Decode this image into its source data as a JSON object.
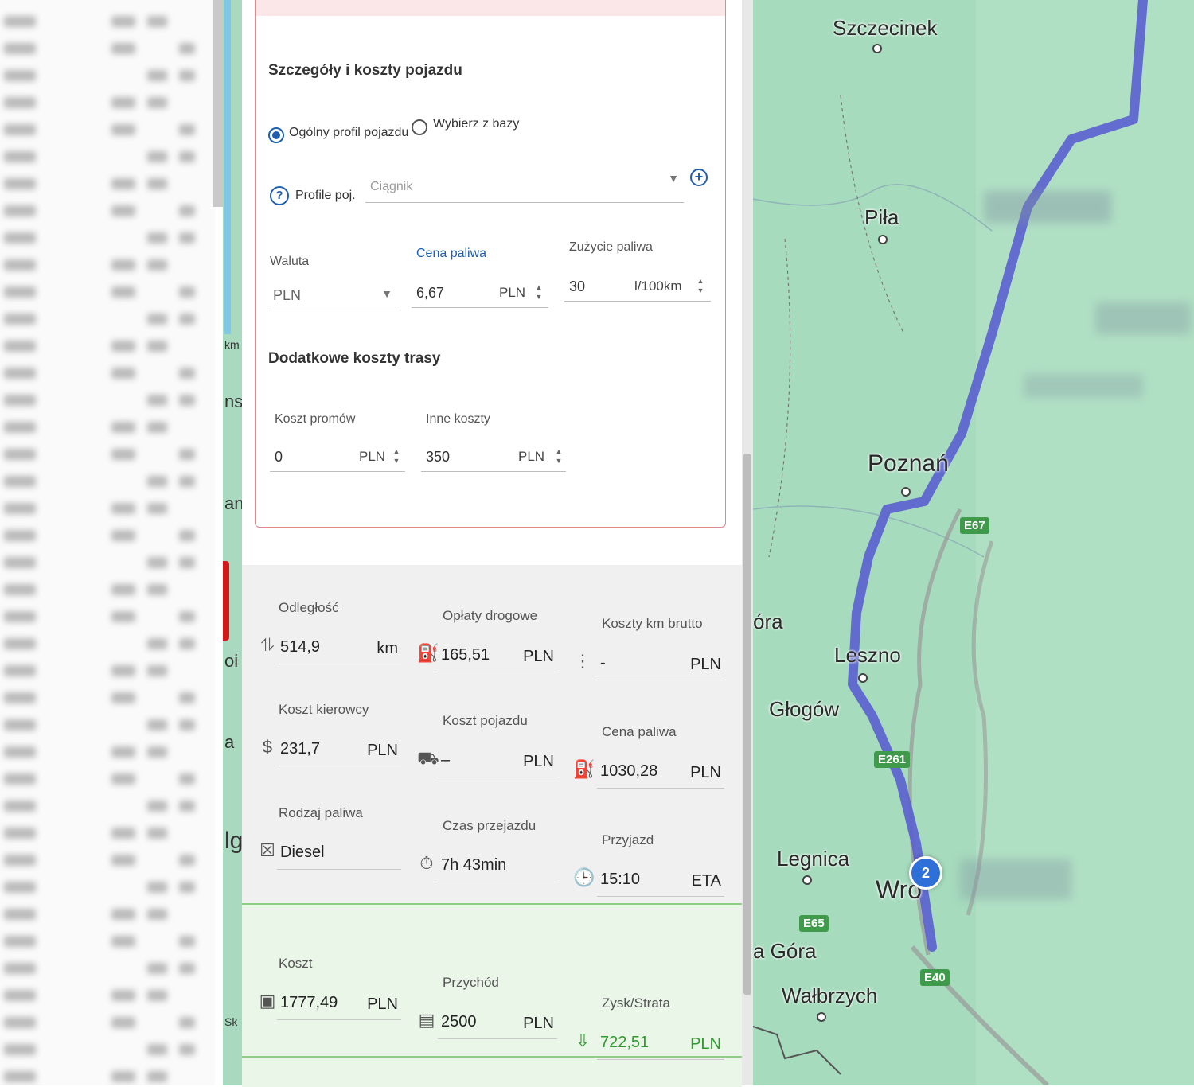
{
  "vehicle_section": {
    "title": "Szczegóły i koszty pojazdu",
    "radio_general": "Ogólny profil pojazdu",
    "radio_database": "Wybierz z bazy",
    "radio_selected": "general",
    "profile_label": "Profile poj.",
    "profile_placeholder": "Ciągnik",
    "currency_label": "Waluta",
    "currency_value": "PLN",
    "fuel_price_label": "Cena paliwa",
    "fuel_price_value": "6,67",
    "fuel_price_unit": "PLN",
    "fuel_consumption_label": "Zużycie paliwa",
    "fuel_consumption_value": "30",
    "fuel_consumption_unit": "l/100km"
  },
  "extra_costs": {
    "title": "Dodatkowe koszty trasy",
    "ferry_label": "Koszt promów",
    "ferry_value": "0",
    "ferry_unit": "PLN",
    "other_label": "Inne koszty",
    "other_value": "350",
    "other_unit": "PLN"
  },
  "stats": {
    "distance": {
      "label": "Odległość",
      "value": "514,9",
      "unit": "km"
    },
    "tolls": {
      "label": "Opłaty drogowe",
      "value": "165,51",
      "unit": "PLN"
    },
    "cost_per_km": {
      "label": "Koszty km brutto",
      "value": "-",
      "unit": "PLN"
    },
    "driver_cost": {
      "label": "Koszt kierowcy",
      "value": "231,7",
      "unit": "PLN"
    },
    "vehicle_cost": {
      "label": "Koszt pojazdu",
      "value": "–",
      "unit": "PLN"
    },
    "fuel_cost": {
      "label": "Cena paliwa",
      "value": "1030,28",
      "unit": "PLN"
    },
    "fuel_type": {
      "label": "Rodzaj paliwa",
      "value": "Diesel",
      "unit": ""
    },
    "travel_time": {
      "label": "Czas przejazdu",
      "value": "7h 43min",
      "unit": ""
    },
    "arrival": {
      "label": "Przyjazd",
      "value": "15:10",
      "unit": "ETA"
    }
  },
  "totals": {
    "cost": {
      "label": "Koszt",
      "value": "1777,49",
      "unit": "PLN"
    },
    "revenue": {
      "label": "Przychód",
      "value": "2500",
      "unit": "PLN"
    },
    "profit": {
      "label": "Zysk/Strata",
      "value": "722,51",
      "unit": "PLN"
    }
  },
  "map": {
    "cities": {
      "szczecinek": "Szczecinek",
      "pila": "Piła",
      "poznan": "Poznań",
      "leszno": "Leszno",
      "glogow": "Głogów",
      "legnica": "Legnica",
      "wroclaw": "Wro",
      "jelenia_gora": "a Góra",
      "walbrzych": "Wałbrzych",
      "zielona_gora": "óra"
    },
    "roads": {
      "e65": "E65",
      "e261": "E261",
      "e67": "E67",
      "e40": "E40"
    },
    "pin_label": "2",
    "route_color": "#5b5fd0"
  },
  "side_strip": {
    "t1": "km",
    "t2": "ns",
    "t3": "an",
    "t4": "oi",
    "t5": "a",
    "t6": "lg",
    "t7": "Sk"
  },
  "colors": {
    "accent": "#1f5fae",
    "card_border": "#e08989",
    "profit_green": "#2e9b2e"
  }
}
